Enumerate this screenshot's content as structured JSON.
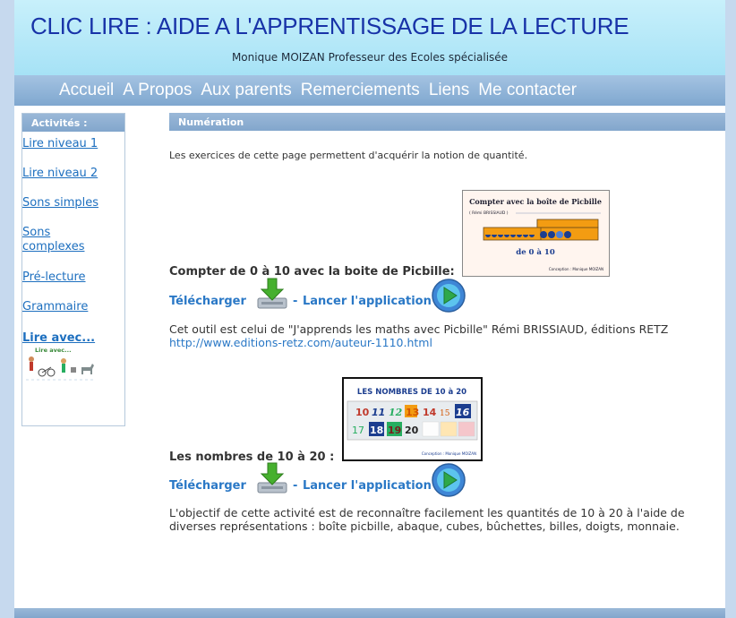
{
  "header": {
    "title": "CLIC LIRE : AIDE A L'APPRENTISSAGE DE LA LECTURE",
    "subtitle": "Monique MOIZAN Professeur des Ecoles spécialisée"
  },
  "nav": [
    "Accueil",
    "A Propos",
    "Aux parents",
    "Remerciements",
    "Liens",
    "Me contacter"
  ],
  "sidebar": {
    "heading": "Activités :",
    "items": [
      "Lire niveau 1",
      "Lire niveau 2",
      "Sons simples",
      "Sons complexes",
      "Pré-lecture",
      "Grammaire"
    ],
    "lire_avec": "Lire avec...",
    "thumb_title": "Lire avec..."
  },
  "content": {
    "heading": "Numération",
    "intro": "Les exercices de cette page permettent d'acquérir la notion de quantité.",
    "download_label": "Télécharger",
    "separator": "-",
    "launch_label": "Lancer l'application",
    "exercises": [
      {
        "title": "Compter de 0 à 10 avec la boite de Picbille:",
        "desc": "Cet outil est celui de \"J'apprends les maths avec Picbille\" Rémi BRISSIAUD, éditions RETZ",
        "link": "http://www.editions-retz.com/auteur-1110.html",
        "thumb": {
          "title": "Compter avec la boîte de Picbille",
          "author_line": "( Rémi BRISSIAUD )",
          "caption": "de 0 à 10",
          "credit": "Conception : Monique MOIZAN"
        }
      },
      {
        "title": "Les nombres de 10 à 20 :",
        "desc": "L'objectif de cette activité est de reconnaître facilement les quantités de 10 à 20 à l'aide de diverses représentations : boîte picbille, abaque, cubes, bûchettes, billes, doigts, monnaie.",
        "thumb": {
          "title": "LES NOMBRES DE 10 à 20",
          "numbers_row1": [
            "10",
            "11",
            "12",
            "13",
            "14",
            "15",
            "16"
          ],
          "numbers_row2": [
            "17",
            "18",
            "19",
            "20"
          ],
          "credit": "Conception : Monique MOIZAN"
        }
      }
    ]
  },
  "colors": {
    "title": "#1833a8",
    "link": "#2a78c6",
    "nav_bar": "#8fb3d8"
  }
}
